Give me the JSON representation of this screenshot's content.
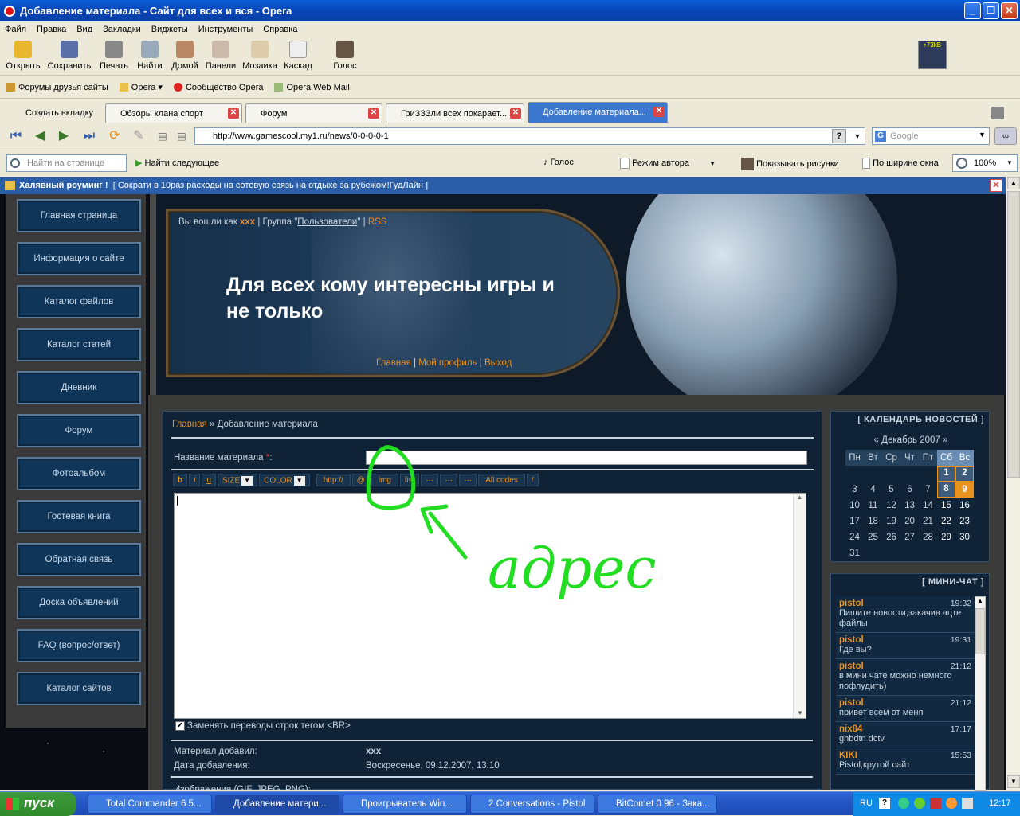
{
  "window": {
    "title": "Добавление материала - Сайт для всех и вся - Opera"
  },
  "menu": [
    "Файл",
    "Правка",
    "Вид",
    "Закладки",
    "Виджеты",
    "Инструменты",
    "Справка"
  ],
  "toolbar": [
    "Открыть",
    "Сохранить",
    "Печать",
    "Найти",
    "Домой",
    "Панели",
    "Мозаика",
    "Каскад",
    "Голос"
  ],
  "netmeter": "↑73kB",
  "bookmarks": [
    "Форумы друзья сайты",
    "Opera",
    "Сообщество Opera",
    "Opera Web Mail"
  ],
  "tabs": {
    "new_tab": "Создать вкладку",
    "items": [
      "Обзоры клана спорт",
      "Форум",
      "ГриЗЗЗли всех покарает...",
      "Добавление материала..."
    ]
  },
  "address": {
    "url": "http://www.gamescool.my1.ru/news/0-0-0-0-1",
    "search_placeholder": "Google"
  },
  "findbar": {
    "find_placeholder": "Найти на странице",
    "find_next": "Найти следующее",
    "voice": "Голос",
    "author_mode": "Режим автора",
    "show_images": "Показывать рисунки",
    "fit_width": "По ширине окна",
    "zoom": "100%"
  },
  "ad": {
    "title": "Халявный роуминг !",
    "text": "[ Сократи в 10раз расходы на сотовую связь на отдыхе за рубежом!ГудЛайн ]"
  },
  "nav": [
    "Главная страница",
    "Информация о сайте",
    "Каталог файлов",
    "Каталог статей",
    "Дневник",
    "Форум",
    "Фотоальбом",
    "Гостевая книга",
    "Обратная связь",
    "Доска объявлений",
    "FAQ (вопрос/ответ)",
    "Каталог сайтов"
  ],
  "header": {
    "logged_as": "Вы вошли как",
    "user": "xxx",
    "group_prefix": "| Группа \"",
    "group": "Пользователи",
    "group_suffix": "\" |",
    "rss": "RSS",
    "hero": "Для всех кому интересны игры и не только",
    "links": [
      "Главная",
      "Мой профиль",
      "Выход"
    ]
  },
  "content": {
    "breadcrumb_home": "Главная",
    "breadcrumb_sep": "»",
    "breadcrumb_current": "Добавление материала",
    "title_label": "Название материала",
    "required_mark": "*",
    "colon": ":",
    "bbcodes": [
      "b",
      "i",
      "u",
      "SIZE",
      "COLOR",
      "http://",
      "@",
      "img",
      "list",
      "···",
      "···",
      "···",
      "All codes",
      "/"
    ],
    "br_label": "Заменять переводы строк тегом <BR>",
    "added_by_label": "Материал добавил:",
    "added_by": "xxx",
    "date_label": "Дата добавления:",
    "date": "Воскресенье, 09.12.2007, 13:10",
    "images_label": "Изображения (GIF, JPEG, PNG):"
  },
  "calendar": {
    "heading": "[ КАЛЕНДАРЬ НОВОСТЕЙ ]",
    "month": "« Декабрь 2007 »",
    "days": [
      "Пн",
      "Вт",
      "Ср",
      "Чт",
      "Пт",
      "Сб",
      "Вс"
    ],
    "weeks": [
      [
        "",
        "",
        "",
        "",
        "",
        "1",
        "2"
      ],
      [
        "3",
        "4",
        "5",
        "6",
        "7",
        "8",
        "9"
      ],
      [
        "10",
        "11",
        "12",
        "13",
        "14",
        "15",
        "16"
      ],
      [
        "17",
        "18",
        "19",
        "20",
        "21",
        "22",
        "23"
      ],
      [
        "24",
        "25",
        "26",
        "27",
        "28",
        "29",
        "30"
      ],
      [
        "31",
        "",
        "",
        "",
        "",
        "",
        ""
      ]
    ]
  },
  "minichat": {
    "heading": "[ МИНИ-ЧАТ ]",
    "messages": [
      {
        "name": "pistol",
        "time": "19:32",
        "text": "Пишите новости,закачив ацте файлы"
      },
      {
        "name": "pistol",
        "time": "19:31",
        "text": "Где вы?"
      },
      {
        "name": "pistol",
        "time": "21:12",
        "text": "в мини чате можно немного пофлудить)"
      },
      {
        "name": "pistol",
        "time": "21:12",
        "text": "привет всем от меня"
      },
      {
        "name": "nix84",
        "time": "17:17",
        "text": "ghbdtn dctv"
      },
      {
        "name": "KIKI",
        "time": "15:53",
        "text": "Pistol,крутой сайт"
      }
    ]
  },
  "annotation": {
    "text": "адрес",
    "color": "#22dd22"
  },
  "taskbar": {
    "start": "пуск",
    "items": [
      "Total Commander 6.5...",
      "Добавление матери...",
      "Проигрыватель Win...",
      "2 Conversations - Pistol",
      "BitComet 0.96 - Зака..."
    ],
    "lang": "RU",
    "clock": "12:17"
  },
  "colors": {
    "accent": "#e8921f",
    "panel": "#0f2236",
    "nav": "#0f3558"
  }
}
